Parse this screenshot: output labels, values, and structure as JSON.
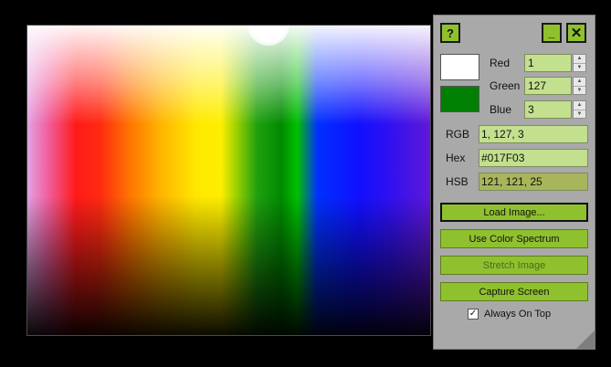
{
  "window": {
    "help_glyph": "?",
    "minimize_glyph": "_",
    "close_glyph": "✕"
  },
  "swatches": {
    "top_color": "#ffffff",
    "bottom_color": "#017f03"
  },
  "rgb_inputs": {
    "red_label": "Red",
    "red_value": "1",
    "green_label": "Green",
    "green_value": "127",
    "blue_label": "Blue",
    "blue_value": "3"
  },
  "readouts": {
    "rgb_label": "RGB",
    "rgb_value": "1, 127, 3",
    "hex_label": "Hex",
    "hex_value": "#017F03",
    "hsb_label": "HSB",
    "hsb_value": "121, 121, 25"
  },
  "buttons": {
    "load_image": "Load Image...",
    "use_spectrum": "Use Color Spectrum",
    "stretch_image": "Stretch Image",
    "capture_screen": "Capture Screen"
  },
  "options": {
    "always_on_top_label": "Always On Top",
    "always_on_top_checked": true,
    "check_glyph": "✓"
  },
  "colors": {
    "accent": "#8fc12e",
    "field_bg": "#c3e08e",
    "hsb_field_bg": "#a9b55a",
    "panel_bg": "#a9a9a9"
  },
  "icons": {
    "spin_up": "▲",
    "spin_down": "▼"
  }
}
